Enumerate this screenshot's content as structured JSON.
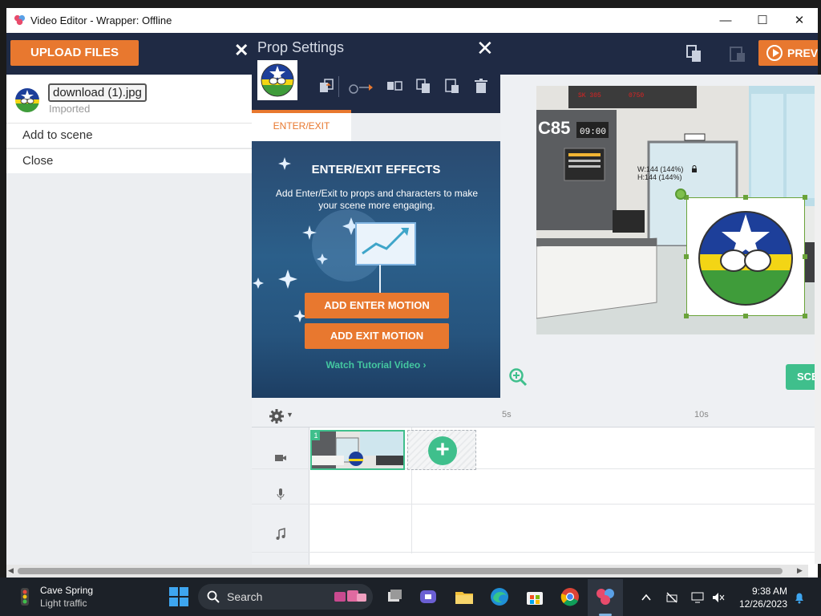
{
  "window": {
    "title": "Video Editor - Wrapper: Offline",
    "minimize_glyph": "—",
    "maximize_glyph": "☐",
    "close_glyph": "✕"
  },
  "header": {
    "upload_label": "UPLOAD FILES",
    "preview_label": "PREV"
  },
  "asset_panel": {
    "file_name": "download (1).jpg",
    "status": "Imported",
    "menu": [
      "Add to scene",
      "Close"
    ]
  },
  "prop_settings": {
    "title": "Prop Settings",
    "close_glyph": "✕",
    "panel_close_glyph": "✕",
    "tab": "ENTER/EXIT",
    "effects_title": "ENTER/EXIT EFFECTS",
    "effects_desc": "Add Enter/Exit to props and characters to make your scene more engaging.",
    "add_enter_label": "ADD ENTER MOTION",
    "add_exit_label": "ADD EXIT MOTION",
    "watch_label": "Watch Tutorial Video  ›"
  },
  "stage": {
    "size_w": "W:144 (144%)",
    "size_h": "H:144 (144%)",
    "scene_button": "SCE",
    "scene_sign": "C85",
    "scene_clock": "09:00"
  },
  "timeline": {
    "ruler": [
      "5s",
      "10s"
    ],
    "clip_number": "1",
    "add_glyph": "+"
  },
  "taskbar": {
    "weather_title": "Cave Spring",
    "weather_sub": "Light traffic",
    "search_label": "Search",
    "time": "9:38 AM",
    "date": "12/26/2023"
  },
  "colors": {
    "accent_orange": "#e8782f",
    "navy": "#1f2a44",
    "green": "#3fbf8c"
  }
}
